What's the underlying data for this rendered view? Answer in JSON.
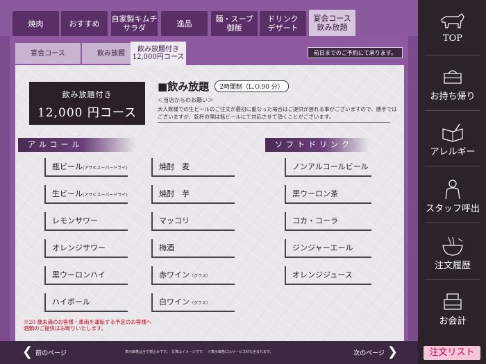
{
  "top_tabs": [
    "焼肉",
    "おすすめ",
    "自家製キムチ\nサラダ",
    "逸品",
    "麺・スープ\n御飯",
    "ドリンク\nデザート",
    "宴会コース\n飲み放題"
  ],
  "sub_tabs": [
    "宴会コース",
    "飲み放題",
    "飲み放題付き\n12,000円コース"
  ],
  "notice": "前日までのご予約にて承ります。",
  "course": {
    "line1": "飲み放題付き",
    "line2": "12,000 円コース"
  },
  "plan": {
    "title": "■飲み放題",
    "tag": "2時間制（L.O.90 分）",
    "request_title": "＜当店からのお願い＞",
    "request_text": "大人数様での生ビールのご注文が最初に重なった場合はご提供が遅れる事がございますので、勝手ではございますが、乾杯の際は瓶ビールにて対応させて頂くことがございます。"
  },
  "alcohol": {
    "heading": "アルコール",
    "col1": [
      {
        "name": "瓶ビール",
        "note": "(アサヒスーパードライ)"
      },
      {
        "name": "生ビール",
        "note": "(アサヒスーパードライ)"
      },
      {
        "name": "レモンサワー",
        "note": ""
      },
      {
        "name": "オレンジサワー",
        "note": ""
      },
      {
        "name": "黒ウーロンハイ",
        "note": ""
      },
      {
        "name": "ハイボール",
        "note": ""
      }
    ],
    "col2": [
      {
        "name": "焼酎　麦",
        "note": ""
      },
      {
        "name": "焼酎　芋",
        "note": ""
      },
      {
        "name": "マッコリ",
        "note": ""
      },
      {
        "name": "梅酒",
        "note": ""
      },
      {
        "name": "赤ワイン",
        "note": "（グラス）"
      },
      {
        "name": "白ワイン",
        "note": "（グラス）"
      }
    ]
  },
  "soft": {
    "heading": "ソフトドリンク",
    "items": [
      "ノンアルコールビール",
      "黒ウーロン茶",
      "コカ・コーラ",
      "ジンジャーエール",
      "オレンジジュース"
    ]
  },
  "warning": "※20 歳未満のお客様・車両を運転する予定のお客様へ\n酒類のご提供はお断りいたします。",
  "footer": {
    "prev": "前のページ",
    "next": "次のページ",
    "note": "表示価格は全て税込みです。　写真はイメージです。　※表示価格にはサービス料も含まれます。"
  },
  "side_nav": [
    {
      "label": "TOP",
      "icon": "cow-icon"
    },
    {
      "label": "お持ち帰り",
      "icon": "takeout-bag-icon"
    },
    {
      "label": "アレルギー",
      "icon": "allergy-book-icon"
    },
    {
      "label": "スタッフ呼出",
      "icon": "staff-icon"
    },
    {
      "label": "注文履歴",
      "icon": "noodle-bowl-icon"
    },
    {
      "label": "お会計",
      "icon": "register-icon"
    }
  ],
  "order_list": "注文リスト"
}
